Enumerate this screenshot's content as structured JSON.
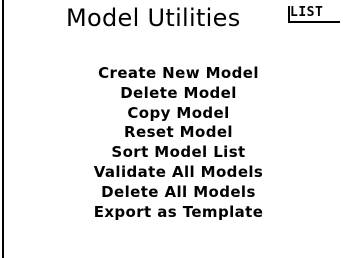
{
  "header": {
    "title": "Model Utilities",
    "list_badge": "LIST"
  },
  "menu": {
    "items": [
      {
        "label": "Create New Model"
      },
      {
        "label": "Delete Model"
      },
      {
        "label": "Copy Model"
      },
      {
        "label": "Reset Model"
      },
      {
        "label": "Sort Model List"
      },
      {
        "label": "Validate All Models"
      },
      {
        "label": "Delete All Models"
      },
      {
        "label": "Export as Template"
      }
    ]
  }
}
